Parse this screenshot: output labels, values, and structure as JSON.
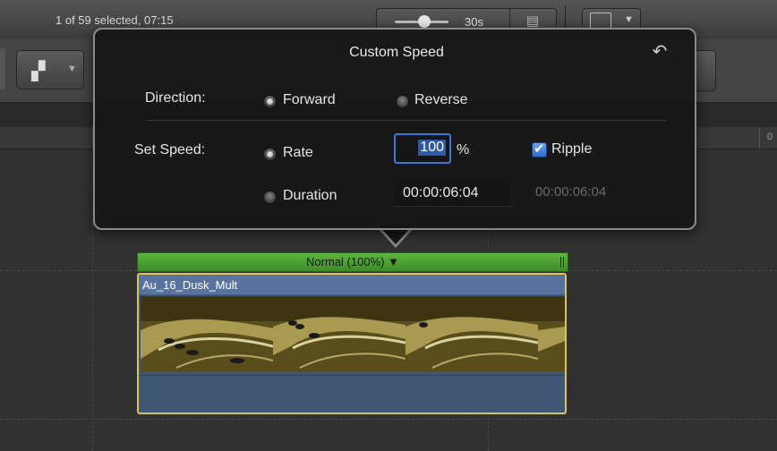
{
  "header": {
    "selection_status": "1 of 59 selected, 07:15",
    "zoom_label": "30s"
  },
  "popover": {
    "title": "Custom Speed",
    "direction": {
      "label": "Direction:",
      "options": [
        "Forward",
        "Reverse"
      ],
      "selected": "Forward"
    },
    "set_speed": {
      "label": "Set Speed:",
      "rate_label": "Rate",
      "rate_value": "100",
      "rate_unit": "%",
      "duration_label": "Duration",
      "duration_value": "00:00:06:04",
      "original_duration": "00:00:06:04",
      "selected": "Rate"
    },
    "ripple": {
      "label": "Ripple",
      "checked": true
    }
  },
  "timeline": {
    "ruler_zero": "0",
    "speed_bar_label": "Normal (100%) ▼",
    "clip_name": "Au_16_Dusk_Mult"
  },
  "colors": {
    "speed_bar": "#4fa534",
    "clip_body": "#3f5675",
    "clip_selection": "#d9c35a",
    "focus_ring": "#3a77d6"
  }
}
